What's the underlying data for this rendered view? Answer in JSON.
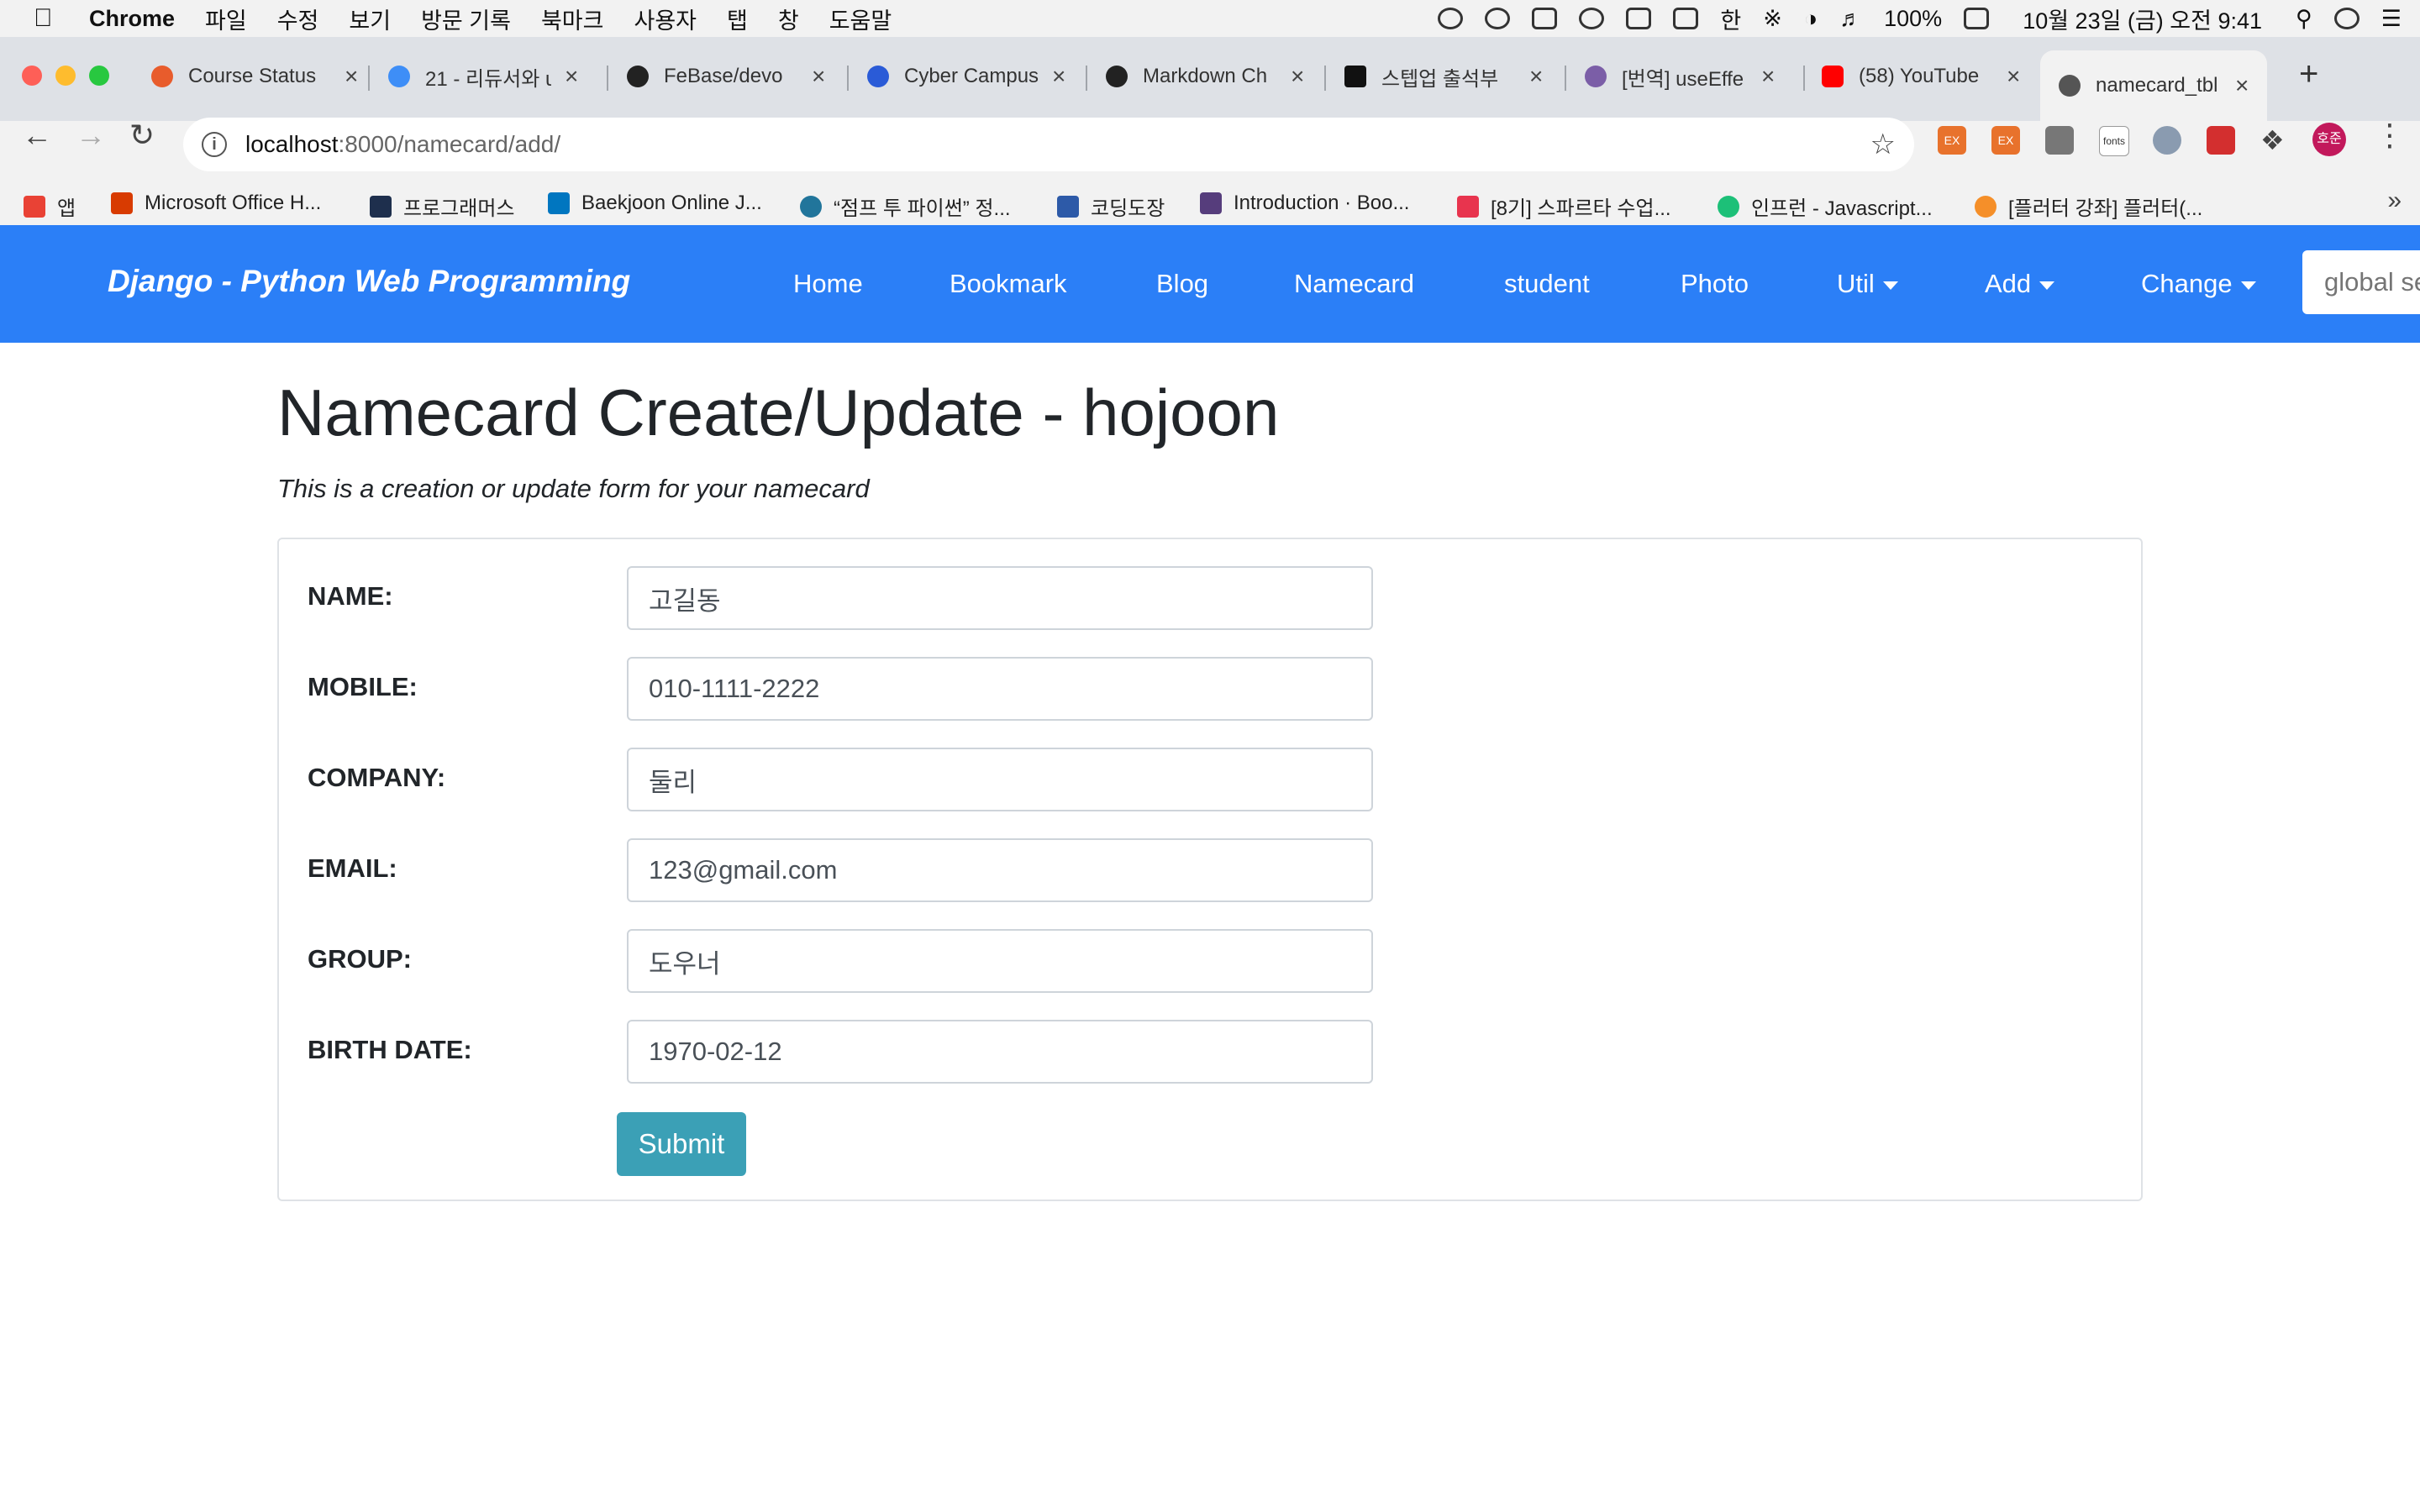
{
  "menubar": {
    "apple_icon": "apple-icon",
    "items": [
      "Chrome",
      "파일",
      "수정",
      "보기",
      "방문 기록",
      "북마크",
      "사용자",
      "탭",
      "창",
      "도움말"
    ],
    "battery": "100%",
    "ime": "한",
    "datetime": "10월 23일 (금) 오전 9:41"
  },
  "tabs": [
    {
      "title": "Course Status",
      "icon_color": "#e85c2c"
    },
    {
      "title": "21 - 리듀서와 u",
      "icon_color": "#3e8ef7"
    },
    {
      "title": "FeBase/devo",
      "icon_color": "#222222"
    },
    {
      "title": "Cyber Campus",
      "icon_color": "#2a5bd7"
    },
    {
      "title": "Markdown Ch",
      "icon_color": "#222222"
    },
    {
      "title": "스텝업 출석부",
      "icon_color": "#111111"
    },
    {
      "title": "[번역] useEffe",
      "icon_color": "#7b5ea7"
    },
    {
      "title": "(58) YouTube",
      "icon_color": "#ff0000"
    },
    {
      "title": "namecard_tbl",
      "icon_color": "#555555",
      "active": true
    }
  ],
  "toolbar": {
    "url_host": "localhost",
    "url_path": ":8000/namecard/add/"
  },
  "extensions": {
    "ex_label": "EX",
    "fonts_label": "fonts",
    "profile_label": "호준"
  },
  "bookmarks": [
    {
      "label": "앱",
      "icon_color": "#e94235"
    },
    {
      "label": "Microsoft Office H...",
      "icon_color": "#d83b01"
    },
    {
      "label": "프로그래머스",
      "icon_color": "#1e2f4d"
    },
    {
      "label": "Baekjoon Online J...",
      "icon_color": "#0076c0"
    },
    {
      "label": "“점프 투 파이썬” 정...",
      "icon_color": "#21759b"
    },
    {
      "label": "코딩도장",
      "icon_color": "#2d5aa8"
    },
    {
      "label": "Introduction · Boo...",
      "icon_color": "#563d7c"
    },
    {
      "label": "[8기] 스파르타 수업...",
      "icon_color": "#e8344e"
    },
    {
      "label": "인프런 - Javascript...",
      "icon_color": "#1dc078"
    },
    {
      "label": "[플러터 강좌] 플러터(...",
      "icon_color": "#f58f29"
    }
  ],
  "site": {
    "brand": "Django - Python Web Programming",
    "nav": [
      "Home",
      "Bookmark",
      "Blog",
      "Namecard",
      "student",
      "Photo"
    ],
    "dropdowns": [
      "Util",
      "Add",
      "Change"
    ],
    "search_placeholder": "global search"
  },
  "page": {
    "title": "Namecard Create/Update - hojoon",
    "subtitle": "This is a creation or update form for your namecard"
  },
  "form": {
    "fields": [
      {
        "label": "NAME:",
        "value": "고길동"
      },
      {
        "label": "MOBILE:",
        "value": "010-1111-2222"
      },
      {
        "label": "COMPANY:",
        "value": "둘리"
      },
      {
        "label": "EMAIL:",
        "value": "123@gmail.com"
      },
      {
        "label": "GROUP:",
        "value": "도우너"
      },
      {
        "label": "BIRTH DATE:",
        "value": "1970-02-12"
      }
    ],
    "submit_label": "Submit"
  },
  "colors": {
    "navbar": "#2b7ff7",
    "submit": "#3ba0b6"
  }
}
